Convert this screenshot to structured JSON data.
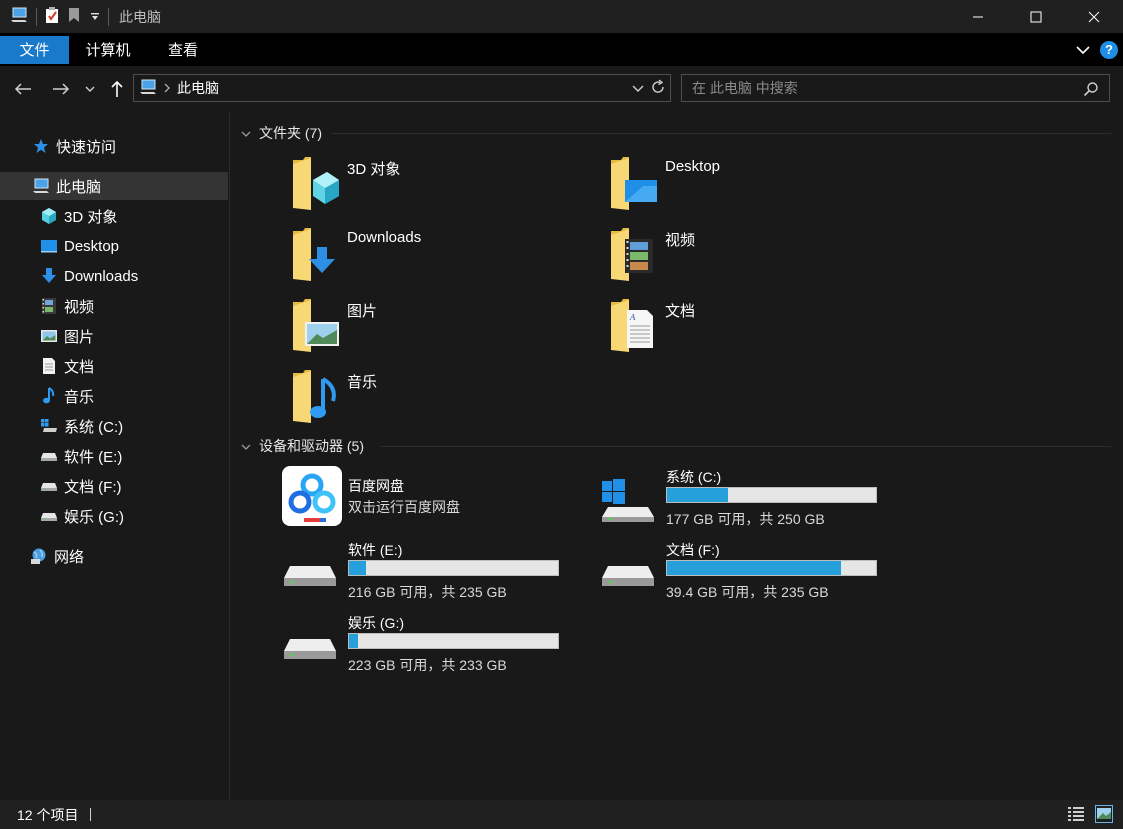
{
  "titlebar": {
    "title": "此电脑",
    "icons": [
      "computer-icon",
      "properties-icon",
      "new-folder-icon",
      "customize-dropdown-icon"
    ],
    "controls": [
      "minimize-icon",
      "maximize-icon",
      "close-icon"
    ]
  },
  "ribbon": {
    "tabs": [
      "文件",
      "计算机",
      "查看"
    ],
    "accent": "#1979ca"
  },
  "address": {
    "crumb": "此电脑",
    "search_placeholder": "在 此电脑 中搜索"
  },
  "sidebar": {
    "items": [
      {
        "label": "快速访问",
        "icon": "star-icon"
      },
      {
        "label": "此电脑",
        "icon": "computer-icon"
      },
      {
        "label": "3D 对象",
        "icon": "3d-objects-icon"
      },
      {
        "label": "Desktop",
        "icon": "desktop-icon"
      },
      {
        "label": "Downloads",
        "icon": "download-icon"
      },
      {
        "label": "视频",
        "icon": "video-icon"
      },
      {
        "label": "图片",
        "icon": "picture-icon"
      },
      {
        "label": "文档",
        "icon": "document-icon"
      },
      {
        "label": "音乐",
        "icon": "music-icon"
      },
      {
        "label": "系统 (C:)",
        "icon": "windows-drive-icon"
      },
      {
        "label": "软件 (E:)",
        "icon": "drive-icon"
      },
      {
        "label": "文档 (F:)",
        "icon": "drive-icon"
      },
      {
        "label": "娱乐 (G:)",
        "icon": "drive-icon"
      },
      {
        "label": "网络",
        "icon": "network-icon"
      }
    ]
  },
  "main": {
    "folders_header": "文件夹 (7)",
    "folders": [
      {
        "name": "3D 对象",
        "overlay": "3d-cube"
      },
      {
        "name": "Desktop",
        "overlay": "desktop"
      },
      {
        "name": "Downloads",
        "overlay": "download"
      },
      {
        "name": "视频",
        "overlay": "film"
      },
      {
        "name": "图片",
        "overlay": "picture"
      },
      {
        "name": "文档",
        "overlay": "document"
      },
      {
        "name": "音乐",
        "overlay": "music"
      }
    ],
    "devices_header": "设备和驱动器 (5)",
    "app": {
      "name": "百度网盘",
      "subtitle": "双击运行百度网盘"
    },
    "drives": [
      {
        "name": "系统 (C:)",
        "info": "177 GB 可用，共 250 GB",
        "used_fraction": 0.292,
        "windows": true
      },
      {
        "name": "软件 (E:)",
        "info": "216 GB 可用，共 235 GB",
        "used_fraction": 0.081,
        "windows": false
      },
      {
        "name": "文档 (F:)",
        "info": "39.4 GB 可用，共 235 GB",
        "used_fraction": 0.832,
        "windows": false
      },
      {
        "name": "娱乐 (G:)",
        "info": "223 GB 可用，共 233 GB",
        "used_fraction": 0.043,
        "windows": false
      }
    ]
  },
  "status": {
    "count": "12 个项目"
  },
  "colors": {
    "bar_fill": "#26a0da",
    "bar_bg": "#e6e6e6",
    "folder_yellow": "#f8d775",
    "background": "#191919"
  }
}
